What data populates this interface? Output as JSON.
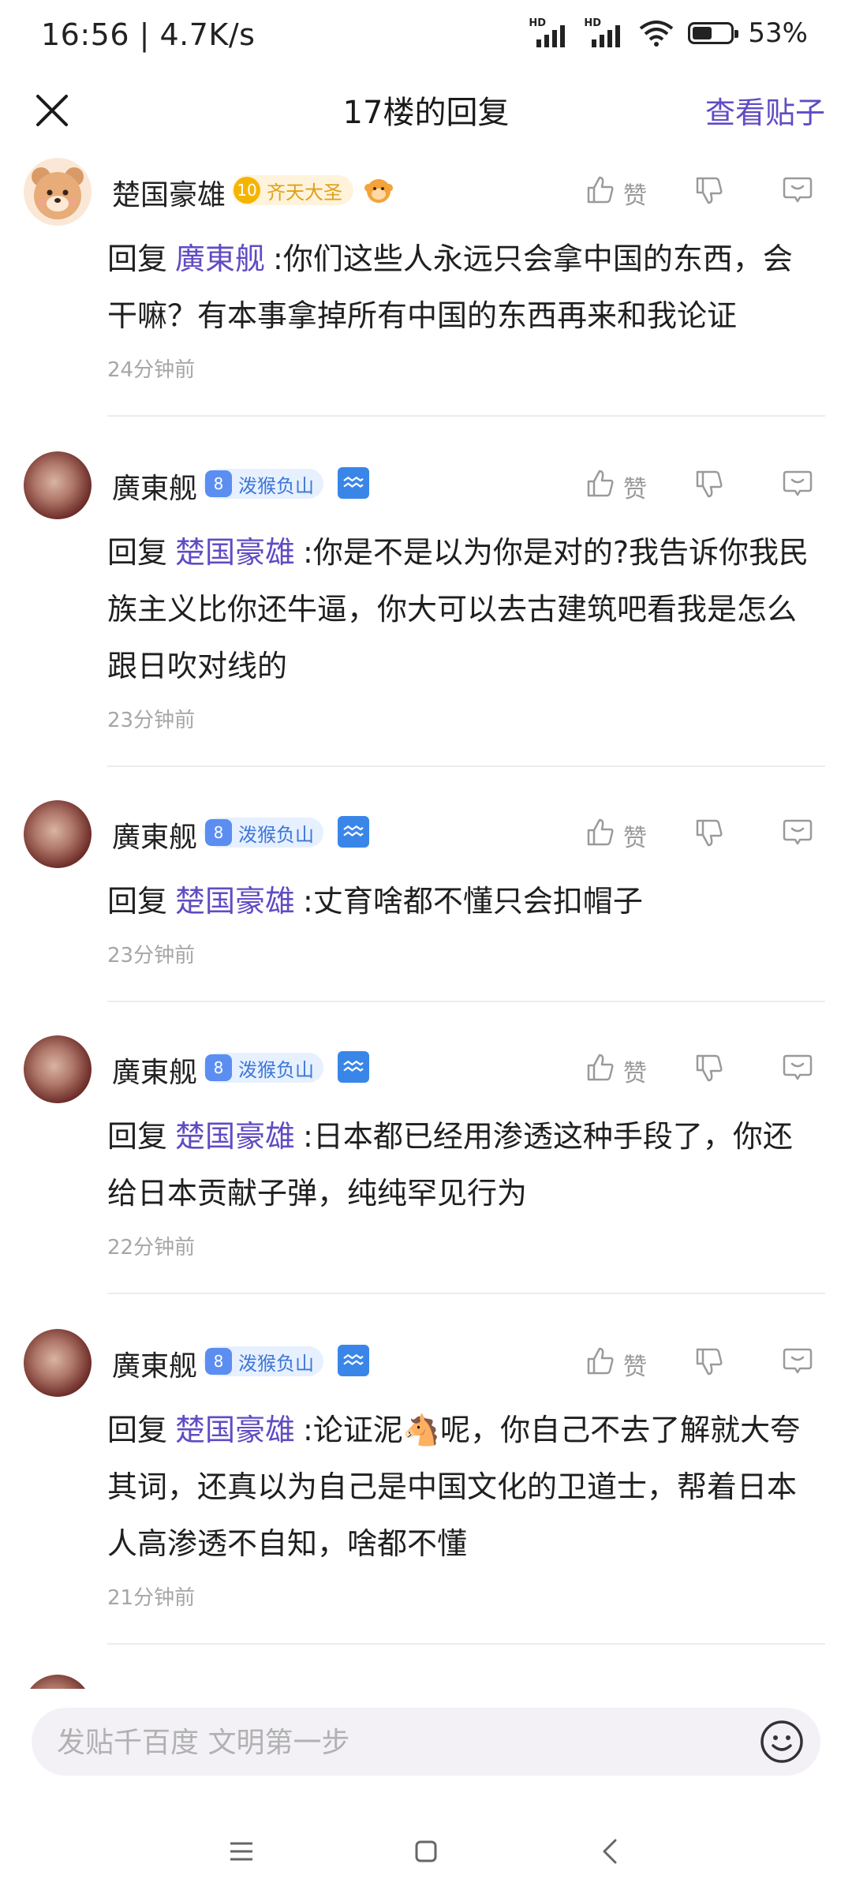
{
  "status_bar": {
    "time_speed": "16:56 | 4.7K/s",
    "hd1": "HD",
    "hd2": "HD",
    "battery": "53%",
    "battery_level": 0.53
  },
  "header": {
    "title": "17楼的回复",
    "view_post": "查看贴子"
  },
  "badge_gold": {
    "level": "10",
    "name": "齐天大圣"
  },
  "badge_blue": {
    "level": "8",
    "name": "泼猴负山"
  },
  "like_label": "赞",
  "replies": [
    {
      "user": "楚国豪雄",
      "prefix": "回复",
      "mention": "廣東舰",
      "text": ":你们这些人永远只会拿中国的东西，会干嘛？有本事拿掉所有中国的东西再来和我论证",
      "time": "24分钟前"
    },
    {
      "user": "廣東舰",
      "prefix": "回复",
      "mention": "楚国豪雄",
      "text": ":你是不是以为你是对的?我告诉你我民族主义比你还牛逼，你大可以去古建筑吧看我是怎么跟日吹对线的",
      "time": "23分钟前"
    },
    {
      "user": "廣東舰",
      "prefix": "回复",
      "mention": "楚国豪雄",
      "text": ":丈育啥都不懂只会扣帽子",
      "time": "23分钟前"
    },
    {
      "user": "廣東舰",
      "prefix": "回复",
      "mention": "楚国豪雄",
      "text": ":日本都已经用渗透这种手段了，你还给日本贡献子弹，纯纯罕见行为",
      "time": "22分钟前"
    },
    {
      "user": "廣東舰",
      "prefix": "回复",
      "mention": "楚国豪雄",
      "text": ":论证泥🐴呢，你自己不去了解就大夸其词，还真以为自己是中国文化的卫道士，帮着日本人高渗透不自知，啥都不懂",
      "time": "21分钟前"
    }
  ],
  "input": {
    "placeholder": "发贴千百度 文明第一步"
  }
}
